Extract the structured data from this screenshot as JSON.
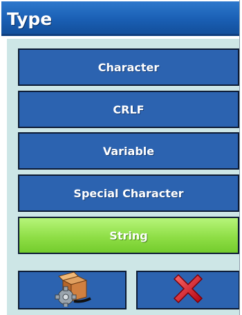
{
  "title": "Type",
  "options": [
    {
      "label": "Character",
      "selected": false
    },
    {
      "label": "CRLF",
      "selected": false
    },
    {
      "label": "Variable",
      "selected": false
    },
    {
      "label": "Special Character",
      "selected": false
    },
    {
      "label": "String",
      "selected": true
    }
  ],
  "footer": {
    "left_icon": "box-gear-icon",
    "right_icon": "red-x-icon"
  },
  "colors": {
    "title_bar": "#1a5fb4",
    "background": "#cde6e6",
    "button": "#2c63b0",
    "selected": "#8fde46"
  }
}
